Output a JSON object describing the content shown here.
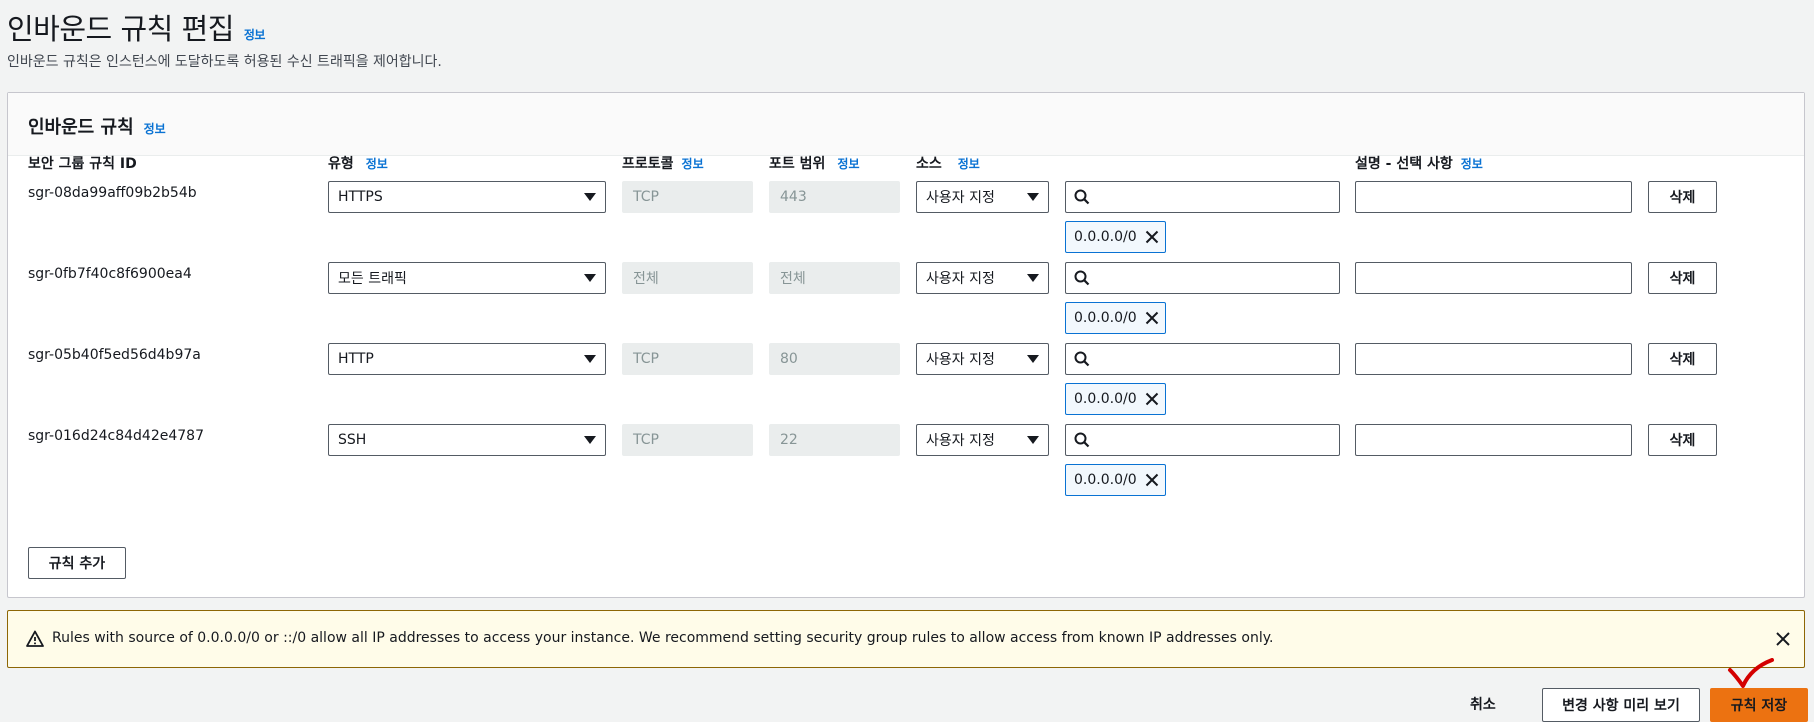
{
  "header": {
    "title": "인바운드 규칙 편집",
    "info": "정보",
    "description": "인바운드 규칙은 인스턴스에 도달하도록 허용된 수신 트래픽을 제어합니다."
  },
  "panel": {
    "title": "인바운드 규칙",
    "info": "정보"
  },
  "columns": {
    "rule_id": "보안 그룹 규칙 ID",
    "type": "유형",
    "protocol": "프로토콜",
    "port_range": "포트 범위",
    "source": "소스",
    "description": "설명 - 선택 사항",
    "info": "정보"
  },
  "rules": [
    {
      "id": "sgr-08da99aff09b2b54b",
      "type": "HTTPS",
      "protocol": "TCP",
      "port": "443",
      "source_type": "사용자 지정",
      "search_value": "",
      "cidr": "0.0.0.0/0",
      "description": "",
      "delete_label": "삭제"
    },
    {
      "id": "sgr-0fb7f40c8f6900ea4",
      "type": "모든 트래픽",
      "protocol": "전체",
      "port": "전체",
      "source_type": "사용자 지정",
      "search_value": "",
      "cidr": "0.0.0.0/0",
      "description": "",
      "delete_label": "삭제"
    },
    {
      "id": "sgr-05b40f5ed56d4b97a",
      "type": "HTTP",
      "protocol": "TCP",
      "port": "80",
      "source_type": "사용자 지정",
      "search_value": "",
      "cidr": "0.0.0.0/0",
      "description": "",
      "delete_label": "삭제"
    },
    {
      "id": "sgr-016d24c84d42e4787",
      "type": "SSH",
      "protocol": "TCP",
      "port": "22",
      "source_type": "사용자 지정",
      "search_value": "",
      "cidr": "0.0.0.0/0",
      "description": "",
      "delete_label": "삭제"
    }
  ],
  "add_rule_label": "규칙 추가",
  "warning": {
    "text": "Rules with source of 0.0.0.0/0 or ::/0 allow all IP addresses to access your instance. We recommend setting security group rules to allow access from known IP addresses only."
  },
  "footer": {
    "cancel": "취소",
    "preview": "변경 사항 미리 보기",
    "save": "규칙 저장"
  },
  "colors": {
    "primary": "#ec7211",
    "link": "#0972d3",
    "warning_bg": "#fffce9",
    "annotation": "#d40000"
  },
  "icons": [
    "search-icon",
    "remove-token-icon",
    "warning-icon",
    "dismiss-icon",
    "caret-down-icon",
    "checkmark-annotation-icon"
  ]
}
